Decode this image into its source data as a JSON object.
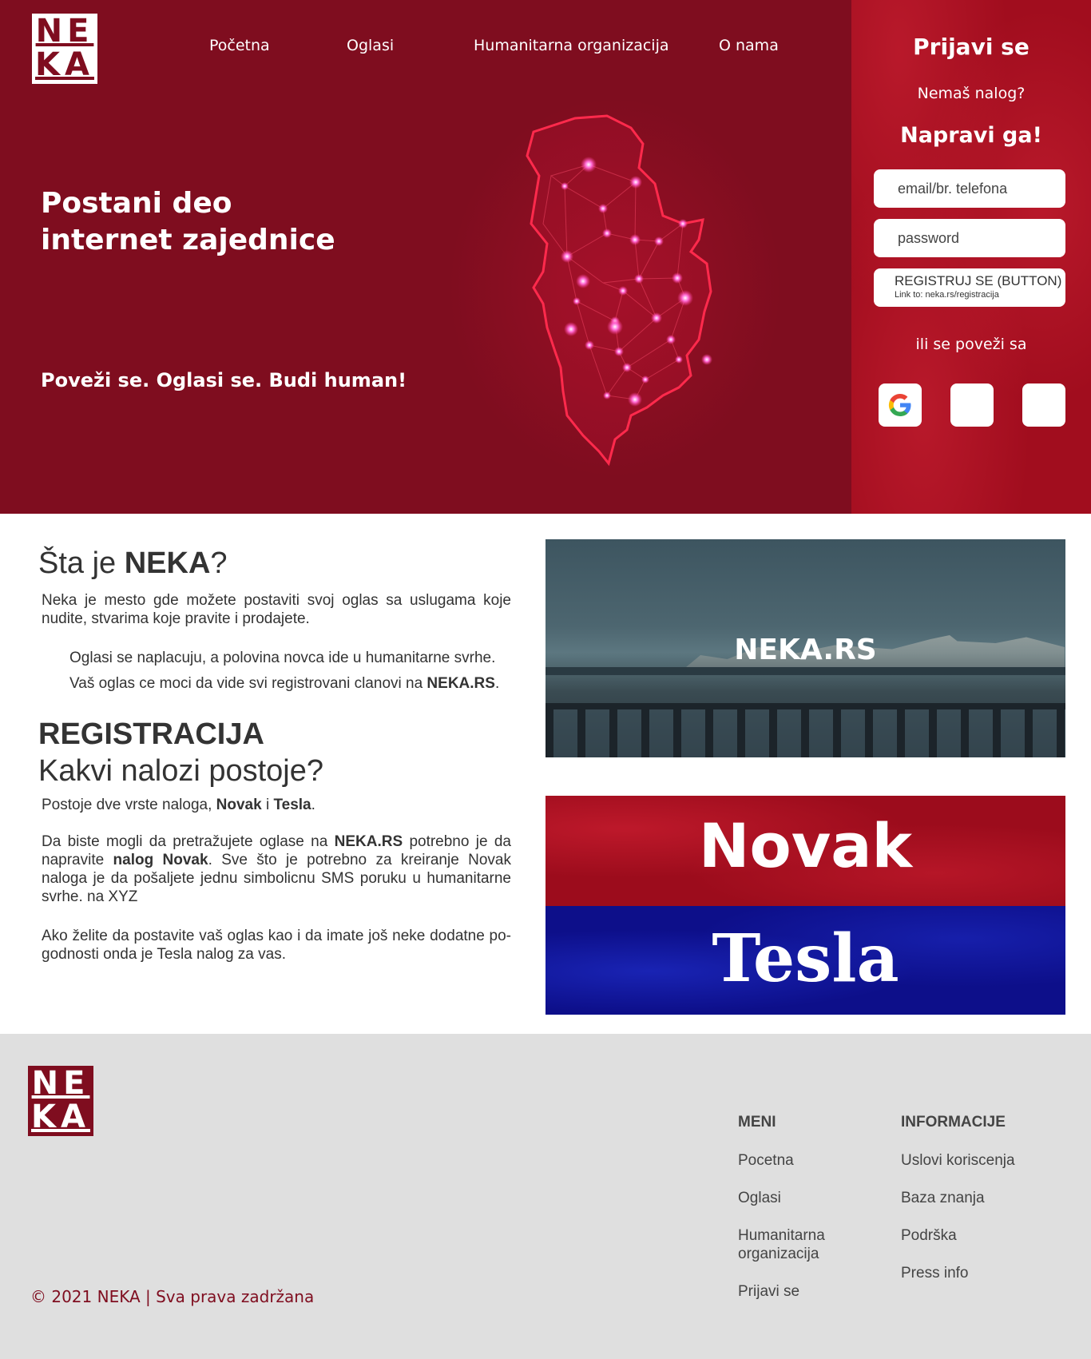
{
  "brand": {
    "logo_top": "NE",
    "logo_bottom": "KA",
    "color": "#7f0d1f"
  },
  "nav": [
    {
      "label": "Početna"
    },
    {
      "label": "Oglasi"
    },
    {
      "label": "Humanitarna organizacija"
    },
    {
      "label": "O nama"
    }
  ],
  "hero": {
    "title_line1": "Postani deo",
    "title_line2": "internet zajednice",
    "tagline": "Poveži se.  Oglasi se.  Budi human!",
    "map": "serbia-network-map"
  },
  "login": {
    "title": "Prijavi se",
    "no_account": "Nemaš nalog?",
    "make_one": "Napravi ga!",
    "email_placeholder": "email/br. telefona",
    "password_placeholder": "password",
    "register_label": "REGISTRUJ SE (BUTTON)",
    "register_link_note": "Link to: neka.rs/registracija",
    "or_connect": "ili se poveži sa",
    "social": [
      "google-icon",
      "social-2",
      "social-3"
    ]
  },
  "about": {
    "heading_pre": "Šta je ",
    "heading_bold": "NEKA",
    "heading_post": "?",
    "p1": "Neka je mesto gde možete postaviti svoj oglas sa uslugama koje nudite, stvarima koje pravite i prodajete.",
    "p2_line1": "Oglasi se naplacuju, a polovina novca ide u humanitarne svrhe.",
    "p2_line2_pre": "Vaš oglas ce moci da vide svi registrovani clanovi na ",
    "p2_line2_bold": "NEKA.RS",
    "p2_line2_post": "."
  },
  "registration": {
    "heading": "REGISTRACIJA",
    "subheading": "Kakvi nalozi postoje?",
    "p1_pre": "Postoje dve vrste naloga, ",
    "p1_b1": "Novak",
    "p1_mid": " i ",
    "p1_b2": "Tesla",
    "p1_post": ".",
    "p2_a": "Da biste mogli da pretražujete oglase na ",
    "p2_b": "NEKA.RS",
    "p2_c": " potrebno je da napravite ",
    "p2_d": "nalog Novak",
    "p2_e": ". Sve što je potrebno za kreiranje Novak naloga je da pošaljete jednu simbolicnu SMS poruku u humanitarne svrhe. na XYZ",
    "p3": "Ako želite da postavite vaš oglas kao i da imate još neke dodatne po-godnosti onda je Tesla nalog za vas."
  },
  "images": {
    "neka_caption": "NEKA.RS",
    "novak": "Novak",
    "tesla": "Tesla"
  },
  "footer": {
    "menu_heading": "MENI",
    "menu": [
      "Pocetna",
      "Oglasi",
      "Humanitarna organizacija",
      "Prijavi se"
    ],
    "info_heading": "INFORMACIJE",
    "info": [
      "Uslovi koriscenja",
      "Baza znanja",
      "Podrška",
      "Press info"
    ],
    "copyright": "© 2021 NEKA | Sva prava zadržana"
  }
}
